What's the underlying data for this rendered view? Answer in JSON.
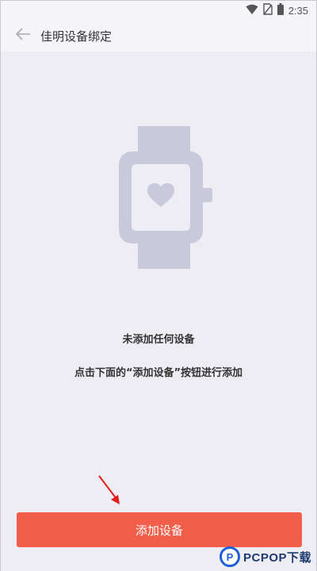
{
  "status_bar": {
    "time": "2:35",
    "icons": [
      "wifi-icon",
      "no-sim-icon",
      "battery-icon"
    ]
  },
  "header": {
    "back_icon": "arrow-left-icon",
    "title": "佳明设备绑定"
  },
  "empty_state": {
    "illustration": "smartwatch-heart-icon",
    "title": "未添加任何设备",
    "description": "点击下面的“添加设备”按钮进行添加"
  },
  "add_button": {
    "label": "添加设备"
  },
  "watermark": {
    "logo": "P",
    "text": "PCPOP下载"
  },
  "colors": {
    "accent": "#f25e4a",
    "illustration": "#c9c9dc",
    "arrow": "#e21c1c",
    "watermark": "#1f5fd8"
  }
}
